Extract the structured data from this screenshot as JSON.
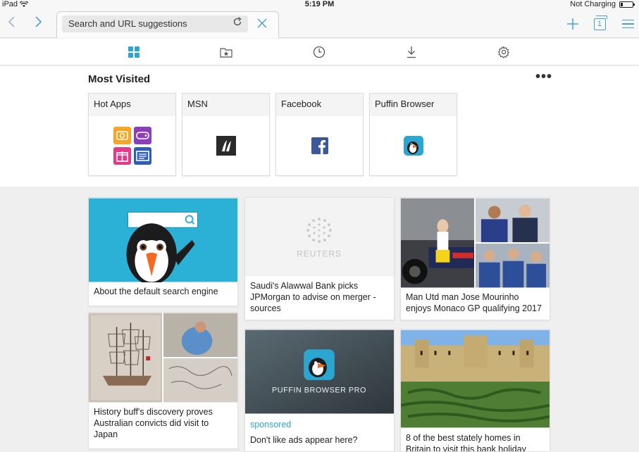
{
  "status": {
    "device": "iPad",
    "time": "5:19 PM",
    "battery": "Not Charging"
  },
  "toolbar": {
    "url_placeholder": "Search and URL suggestions",
    "tab_count": "1"
  },
  "most_visited": {
    "title": "Most Visited",
    "more": "•••",
    "tiles": [
      {
        "label": "Hot Apps"
      },
      {
        "label": "MSN"
      },
      {
        "label": "Facebook"
      },
      {
        "label": "Puffin Browser"
      }
    ]
  },
  "feed": {
    "cards": [
      {
        "caption": "About the default search engine"
      },
      {
        "caption": "Saudi's Alawwal Bank picks JPMorgan to advise on merger - sources",
        "source_logo": "REUTERS"
      },
      {
        "caption": "Man Utd man Jose Mourinho enjoys Monaco GP qualifying 2017"
      },
      {
        "caption": "History buff's discovery proves Australian convicts did visit to Japan"
      },
      {
        "caption": "Don't like ads appear here?",
        "sponsored": "sponsored",
        "banner_text": "PUFFIN BROWSER PRO"
      },
      {
        "caption": "8 of the best stately homes in Britain to visit this bank holiday"
      }
    ]
  },
  "colors": {
    "accent": "#4a9fd8",
    "sponsored": "#2ba6d0",
    "search_engine_bg": "#2bb0d6"
  }
}
